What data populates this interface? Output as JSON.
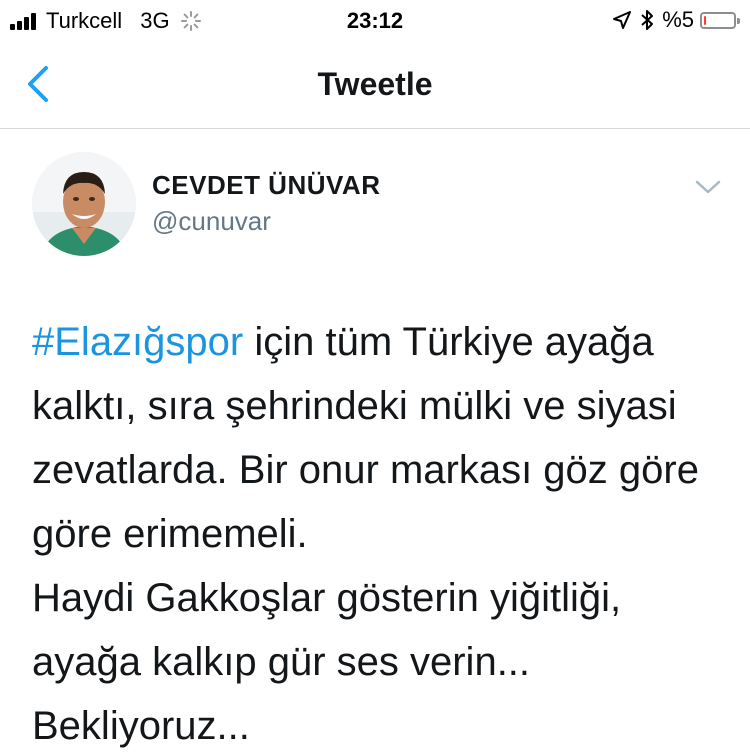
{
  "status_bar": {
    "carrier": "Turkcell",
    "network": "3G",
    "time": "23:12",
    "battery_pct_label": "%5",
    "battery_level": 0.05,
    "battery_color": "#ff3b30"
  },
  "nav": {
    "title": "Tweetle",
    "back_icon": "chevron-left-icon",
    "accent_color": "#1da1f2"
  },
  "tweet": {
    "author_name": "CEVDET ÜNÜVAR",
    "author_handle": "@cunuvar",
    "options_icon": "chevron-down-icon",
    "hashtag_color": "#1b95e0",
    "hashtag": "#Elazığspor",
    "lines": [
      " için tüm Türkiye ayağa",
      "kalktı, sıra şehrindeki mülki ve siyasi",
      "zevatlarda. Bir onur markası göz göre",
      "göre erimemeli.",
      "Haydi Gakkoşlar gösterin yiğitliği,",
      "ayağa kalkıp gür ses verin...",
      "Bekliyoruz..."
    ]
  }
}
